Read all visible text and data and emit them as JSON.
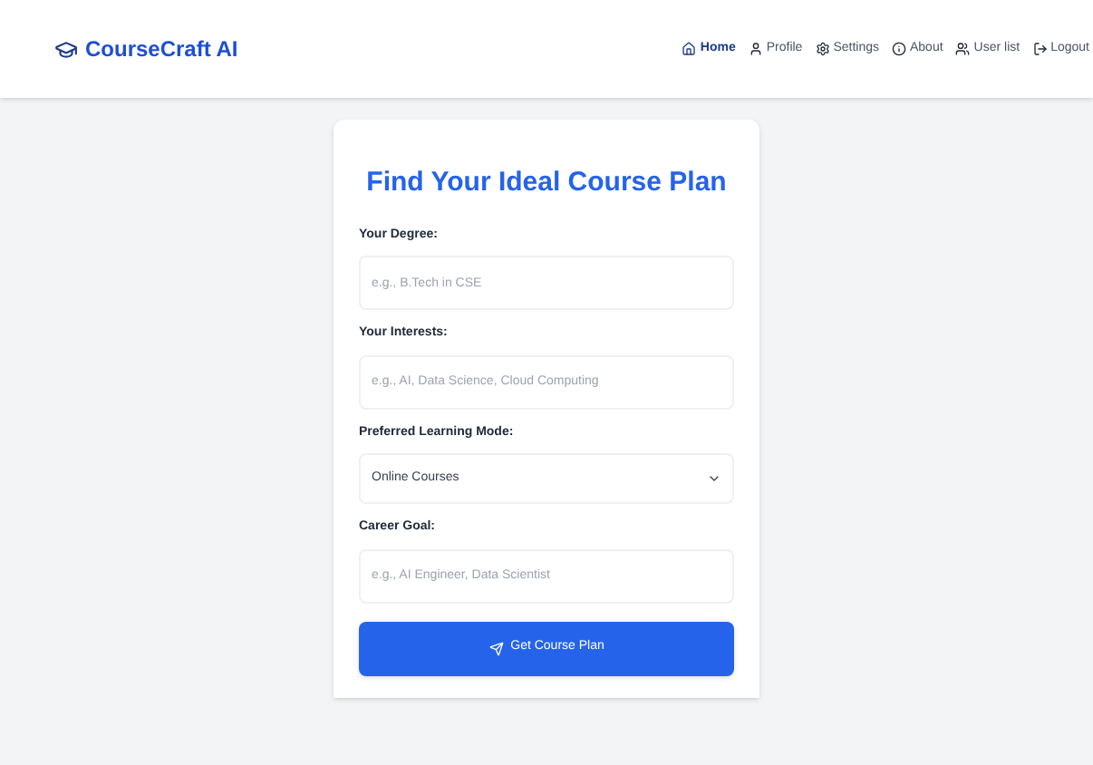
{
  "brand": {
    "name": "CourseCraft AI"
  },
  "nav": [
    {
      "label": "Home",
      "selected": true
    },
    {
      "label": "Profile",
      "selected": false
    },
    {
      "label": "Settings",
      "selected": false
    },
    {
      "label": "About",
      "selected": false
    },
    {
      "label": "User list",
      "selected": false
    },
    {
      "label": "Logout",
      "selected": false
    }
  ],
  "form": {
    "title": "Find Your Ideal Course Plan",
    "fields": [
      {
        "kind": "input",
        "label": "Your Degree:",
        "placeholder": "e.g., B.Tech in CSE"
      },
      {
        "kind": "input",
        "label": "Your Interests:",
        "placeholder": "e.g., AI, Data Science, Cloud Computing"
      },
      {
        "kind": "select",
        "label": "Preferred Learning Mode:",
        "value": "Online Courses"
      },
      {
        "kind": "input",
        "label": "Career Goal:",
        "placeholder": "e.g., AI Engineer, Data Scientist"
      }
    ],
    "submit": "Get Course Plan"
  }
}
